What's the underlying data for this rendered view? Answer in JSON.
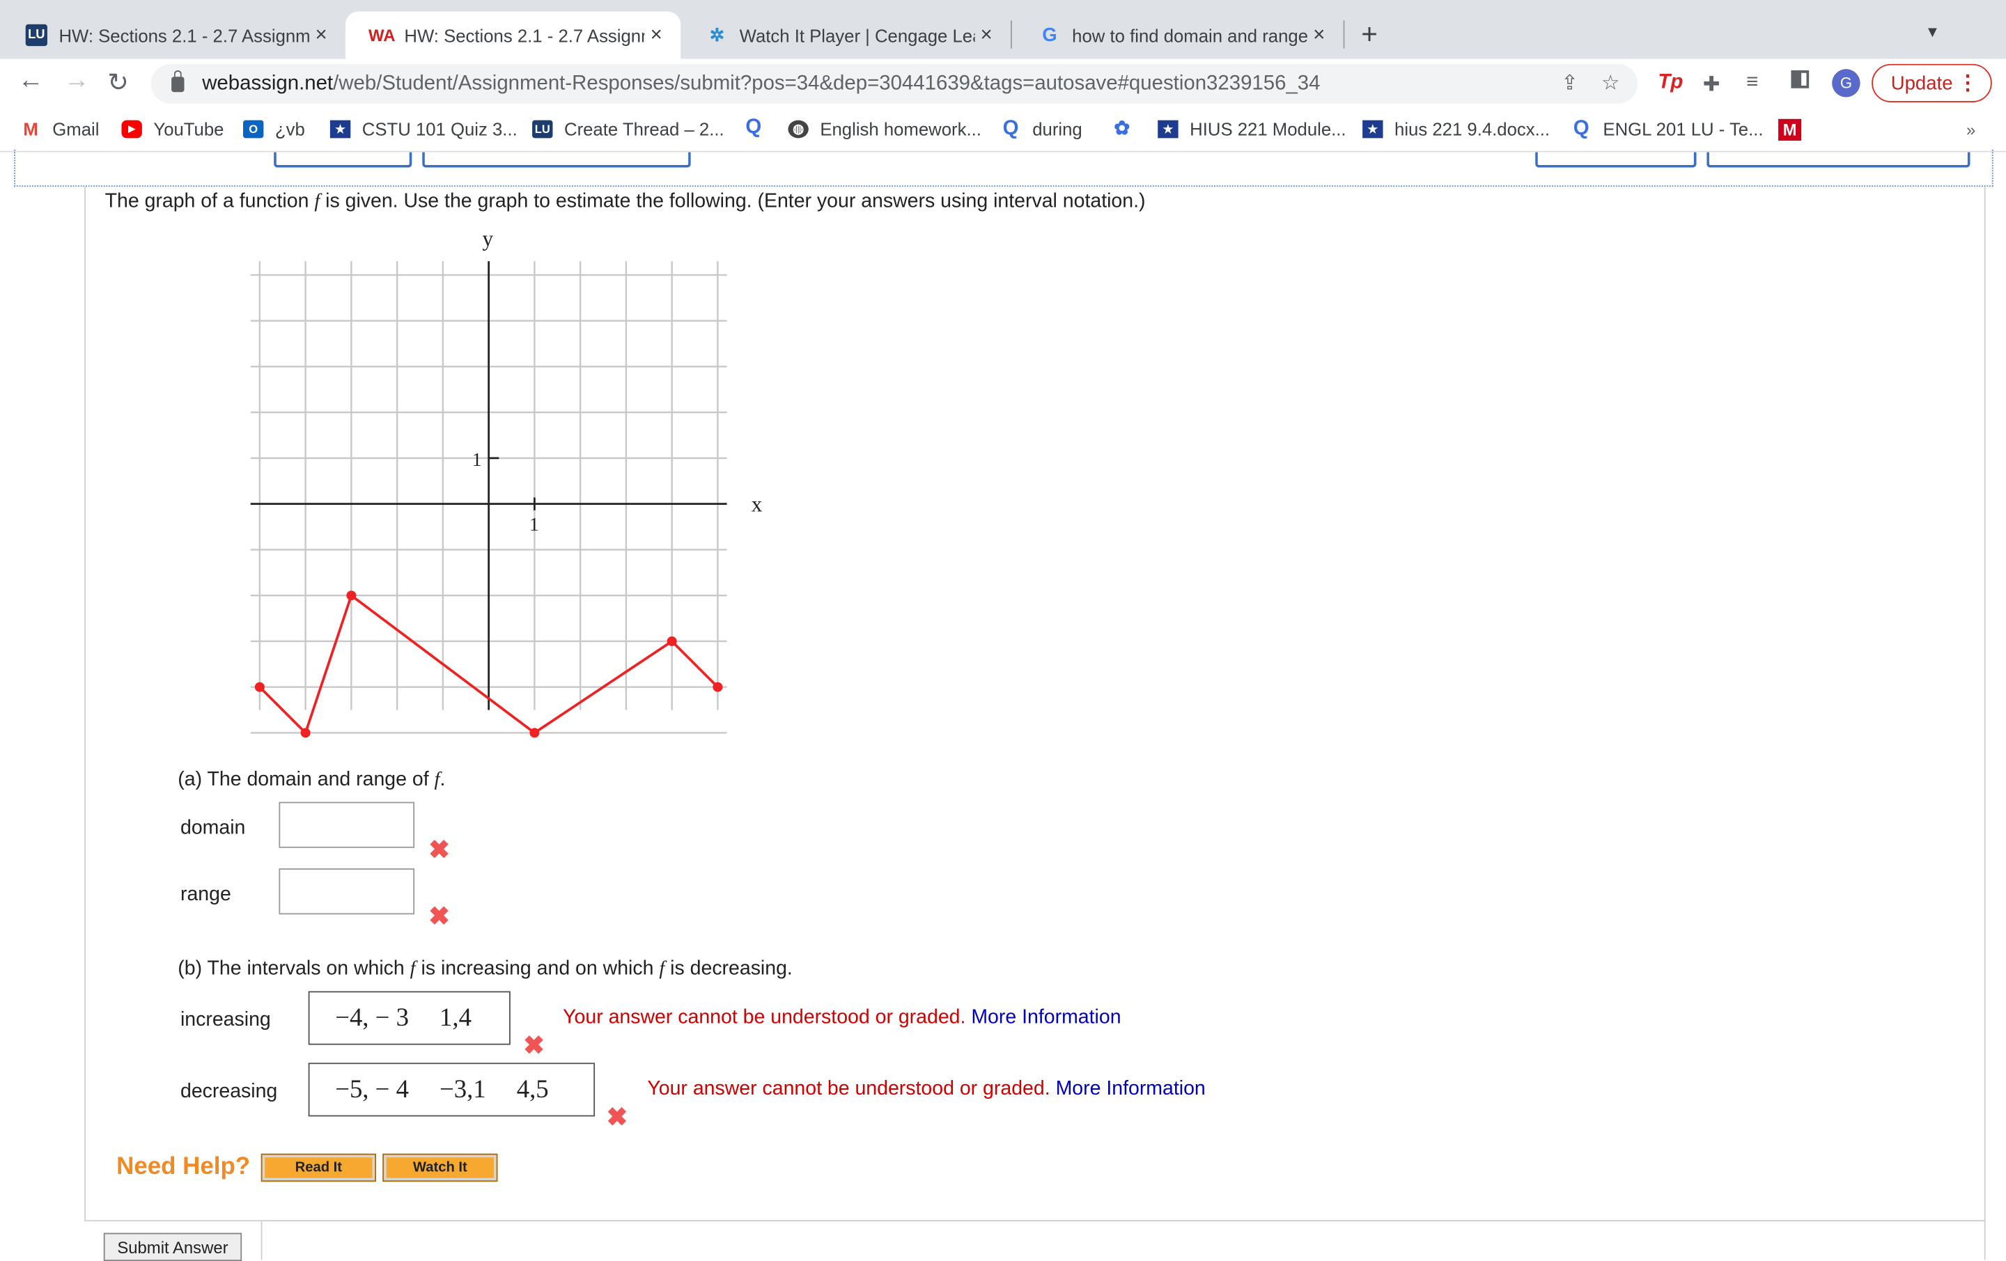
{
  "tabs": [
    {
      "title": "HW: Sections 2.1 - 2.7 Assignm",
      "icon": "lu-icon",
      "close": "×"
    },
    {
      "title": "HW: Sections 2.1 - 2.7 Assignm",
      "icon": "webassign-icon",
      "close": "×"
    },
    {
      "title": "Watch It Player | Cengage Lear",
      "icon": "cengage-icon",
      "close": "×"
    },
    {
      "title": "how to find domain and range o",
      "icon": "google-icon",
      "close": "×"
    }
  ],
  "new_tab": "+",
  "address": {
    "host": "webassign.net",
    "path": "/web/Student/Assignment-Responses/submit?pos=34&dep=30441639&tags=autosave#question3239156_34"
  },
  "toolbar": {
    "profile_initial": "G",
    "update_label": "Update",
    "ext_tp": "Tp"
  },
  "bookmarks": [
    {
      "label": "Gmail",
      "icon": "gmail-icon"
    },
    {
      "label": "YouTube",
      "icon": "youtube-icon"
    },
    {
      "label": "¿vb",
      "icon": "outlook-icon"
    },
    {
      "label": "CSTU 101 Quiz 3...",
      "icon": "star-badge-icon"
    },
    {
      "label": "Create Thread – 2...",
      "icon": "lu-icon"
    },
    {
      "label": "",
      "icon": "search-q-icon"
    },
    {
      "label": "English homework...",
      "icon": "globe-icon"
    },
    {
      "label": "during",
      "icon": "search-q-icon"
    },
    {
      "label": "",
      "icon": "gear-icon"
    },
    {
      "label": "HIUS 221 Module...",
      "icon": "star-badge-icon"
    },
    {
      "label": "hius 221 9.4.docx...",
      "icon": "star-badge-icon"
    },
    {
      "label": "ENGL 201 LU - Te...",
      "icon": "search-q-icon"
    },
    {
      "label": "",
      "icon": "m-icon"
    }
  ],
  "question": {
    "prompt_pre": "The graph of a function ",
    "prompt_f": "f",
    "prompt_post": " is given. Use the graph to estimate the following. (Enter your answers using interval notation.)",
    "part_a_pre": "(a) The domain and range of ",
    "part_a_f": "f",
    "part_a_post": ".",
    "domain_label": "domain",
    "range_label": "range",
    "part_b_pre": "(b) The intervals on which ",
    "part_b_f1": "f",
    "part_b_mid": " is increasing and on which ",
    "part_b_f2": "f",
    "part_b_post": " is decreasing.",
    "increasing_label": "increasing",
    "increasing_parts": [
      "−4, − 3",
      "1,4"
    ],
    "decreasing_label": "decreasing",
    "decreasing_parts": [
      "−5, − 4",
      "−3,1",
      "4,5"
    ],
    "error_text": "Your answer cannot be understood or graded.",
    "more_info": "More Information",
    "need_help": "Need Help?",
    "read_it": "Read It",
    "watch_it": "Watch It",
    "submit": "Submit Answer"
  },
  "chart_data": {
    "type": "line",
    "xlabel": "x",
    "ylabel": "y",
    "x_tick_label": "1",
    "y_tick_label": "1",
    "xlim": [
      -5,
      5
    ],
    "ylim": [
      -5,
      5
    ],
    "grid": true,
    "line_color": "#ee2222",
    "series": [
      {
        "x": [
          -5,
          -4,
          -3,
          1,
          4,
          5
        ],
        "y": [
          -4,
          -5,
          -2,
          -5,
          -3,
          -4
        ]
      }
    ]
  }
}
